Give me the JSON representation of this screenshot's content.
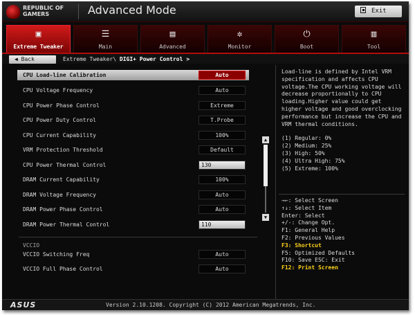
{
  "header": {
    "brand_line1": "REPUBLIC OF",
    "brand_line2": "GAMERS",
    "title": "Advanced Mode",
    "exit_label": "Exit"
  },
  "tabs": [
    {
      "label": "Extreme Tweaker",
      "icon": "cpu-chip-icon",
      "glyph": "▣",
      "active": true
    },
    {
      "label": "Main",
      "icon": "list-icon",
      "glyph": "☰",
      "active": false
    },
    {
      "label": "Advanced",
      "icon": "advanced-settings-icon",
      "glyph": "▤",
      "active": false
    },
    {
      "label": "Monitor",
      "icon": "monitor-fan-icon",
      "glyph": "✲",
      "active": false
    },
    {
      "label": "Boot",
      "icon": "power-icon",
      "glyph": "⏻",
      "active": false
    },
    {
      "label": "Tool",
      "icon": "tool-icon",
      "glyph": "▥",
      "active": false
    }
  ],
  "nav": {
    "back_label": "Back",
    "breadcrumb_prefix": "Extreme Tweaker\\",
    "breadcrumb_current": "DIGI+ Power Control >"
  },
  "settings": [
    {
      "name": "CPU Load-line Calibration",
      "value": "Auto",
      "selected": true,
      "type": "select"
    },
    {
      "name": "CPU Voltage Frequency",
      "value": "Auto",
      "type": "select"
    },
    {
      "name": "CPU Power Phase Control",
      "value": "Extreme",
      "type": "select"
    },
    {
      "name": "CPU Power Duty Control",
      "value": "T.Probe",
      "type": "select"
    },
    {
      "name": "CPU Current Capability",
      "value": "100%",
      "type": "select"
    },
    {
      "name": "VRM Protection Threshold",
      "value": "Default",
      "type": "select"
    },
    {
      "name": "CPU Power Thermal Control",
      "value": "130",
      "type": "input"
    },
    {
      "name": "DRAM Current Capability",
      "value": "100%",
      "type": "select"
    },
    {
      "name": "DRAM Voltage Frequency",
      "value": "Auto",
      "type": "select"
    },
    {
      "name": "DRAM Power Phase Control",
      "value": "Auto",
      "type": "select"
    },
    {
      "name": "DRAM Power Thermal Control",
      "value": "110",
      "type": "input"
    }
  ],
  "vccio": {
    "section_label": "VCCIO",
    "items": [
      {
        "name": "VCCIO Switching Freq",
        "value": "Auto",
        "type": "select"
      },
      {
        "name": "VCCIO Full Phase Control",
        "value": "Auto",
        "type": "select"
      }
    ]
  },
  "help": {
    "description": "Load-line is defined by Intel VRM\nspecification and affects CPU\nvoltage.The CPU working voltage will\ndecrease proportionally to CPU\nloading.Higher value could get\nhigher voltage and good overclocking\nperformance but increase the CPU and\nVRM thermal conditions.",
    "levels": [
      "(1) Regular: 0%",
      "(2) Medium: 25%",
      "(3) High: 50%",
      "(4) Ultra High: 75%",
      "(5) Extreme: 100%"
    ]
  },
  "keys": [
    {
      "text": "→←: Select Screen",
      "highlight": false
    },
    {
      "text": "↑↓: Select Item",
      "highlight": false
    },
    {
      "text": "Enter: Select",
      "highlight": false
    },
    {
      "text": "+/-: Change Opt.",
      "highlight": false
    },
    {
      "text": "F1: General Help",
      "highlight": false
    },
    {
      "text": "F2: Previous Values",
      "highlight": false
    },
    {
      "text": "F3: Shortcut",
      "highlight": true
    },
    {
      "text": "F5: Optimized Defaults",
      "highlight": false
    },
    {
      "text": "F10: Save  ESC: Exit",
      "highlight": false
    },
    {
      "text": "F12: Print Screen",
      "highlight": true
    }
  ],
  "footer": {
    "logo": "ASUS",
    "version": "Version 2.10.1208. Copyright (C) 2012 American Megatrends, Inc."
  },
  "colors": {
    "accent_red": "#c31010",
    "highlight_yellow": "#ffd21a",
    "background": "#0b0b0b"
  }
}
